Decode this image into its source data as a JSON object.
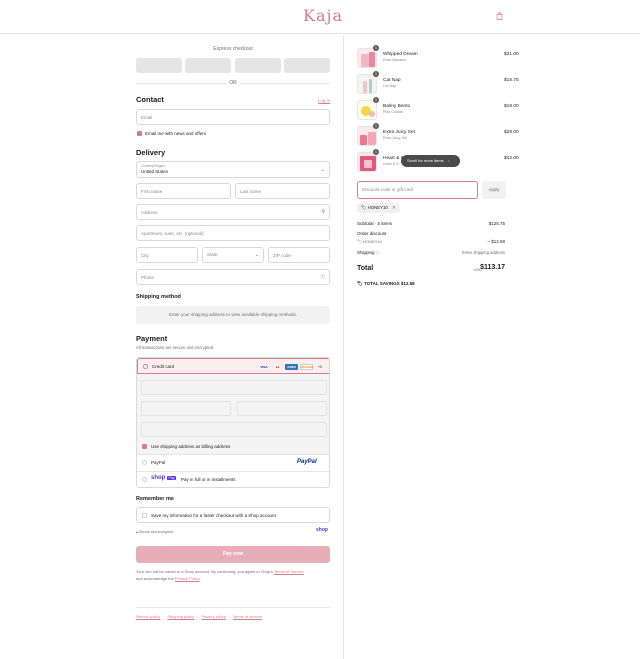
{
  "header": {
    "logo": "Kaja"
  },
  "express": {
    "title": "Express checkout",
    "or": "OR"
  },
  "contact": {
    "title": "Contact",
    "login": "Log in",
    "email_placeholder": "Email",
    "news_label": "Email me with news and offers"
  },
  "delivery": {
    "title": "Delivery",
    "country_label": "Country/Region",
    "country_value": "United States",
    "first_name": "First name",
    "last_name": "Last name",
    "address": "Address",
    "apartment": "Apartment, suite, etc. (optional)",
    "city": "City",
    "state": "State",
    "zip": "ZIP code",
    "phone": "Phone"
  },
  "shipping_method": {
    "title": "Shipping method",
    "message": "Enter your shipping address to view available shipping methods."
  },
  "payment": {
    "title": "Payment",
    "subtitle": "All transactions are secure and encrypted.",
    "credit_card": "Credit card",
    "cards": [
      "VISA",
      "MC",
      "AMEX",
      "DISCOVER"
    ],
    "more_cards": "+6",
    "billing_label": "Use shipping address as billing address",
    "paypal_label": "PayPal",
    "paypal_logo": "PayPal",
    "shoppay_logo": "shop",
    "shoppay_badge": "Pay",
    "shoppay_label": "Pay in full or in installments"
  },
  "remember": {
    "title": "Remember me",
    "label": "Save my information for a faster checkout with a Shop account",
    "secure": "Secure and encrypted",
    "shop": "shop"
  },
  "pay_now": "Pay now",
  "legal": {
    "text1": "Your info will be saved to a Shop account. By continuing, you agree to Shop's ",
    "terms": "Terms of Service",
    "text2": "and acknowledge the ",
    "privacy": "Privacy Policy",
    "end": "."
  },
  "footer": [
    "Refund policy",
    "Shipping policy",
    "Privacy policy",
    "Terms of service"
  ],
  "cart": {
    "items": [
      {
        "name": "Whipped Dream",
        "variant": "Rose Macaron",
        "qty": "1",
        "price": "$21.00"
      },
      {
        "name": "Cat Nap",
        "variant": "Cat Nap",
        "qty": "1",
        "price": "$15.75"
      },
      {
        "name": "Balmy Bento",
        "variant": "Piña Colada",
        "qty": "1",
        "price": "$19.00"
      },
      {
        "name": "Extra Juicy Set",
        "variant": "Extra Juicy Set",
        "qty": "1",
        "price": "$28.00"
      },
      {
        "name": "Heart & S...",
        "variant": "Heart & S...",
        "qty": "1",
        "price": "$42.00"
      }
    ],
    "scroll_hint": "Scroll for more items",
    "discount_placeholder": "Discount code or gift card",
    "apply": "Apply",
    "code": "HONEY10",
    "subtotal_label": "Subtotal · 5 items",
    "subtotal": "$125.75",
    "order_discount_label": "Order discount",
    "discount_code": "HONEY10",
    "discount_value": "– $12.58",
    "shipping_label": "Shipping",
    "shipping_value": "Enter shipping address",
    "total_label": "Total",
    "currency": "USD",
    "total": "$113.17",
    "savings_label": "TOTAL SAVINGS",
    "savings": "$12.58"
  },
  "colors": {
    "accent": "#d77c8a",
    "pay_button": "#e8aeb7",
    "shop_purple": "#5a31f4"
  }
}
